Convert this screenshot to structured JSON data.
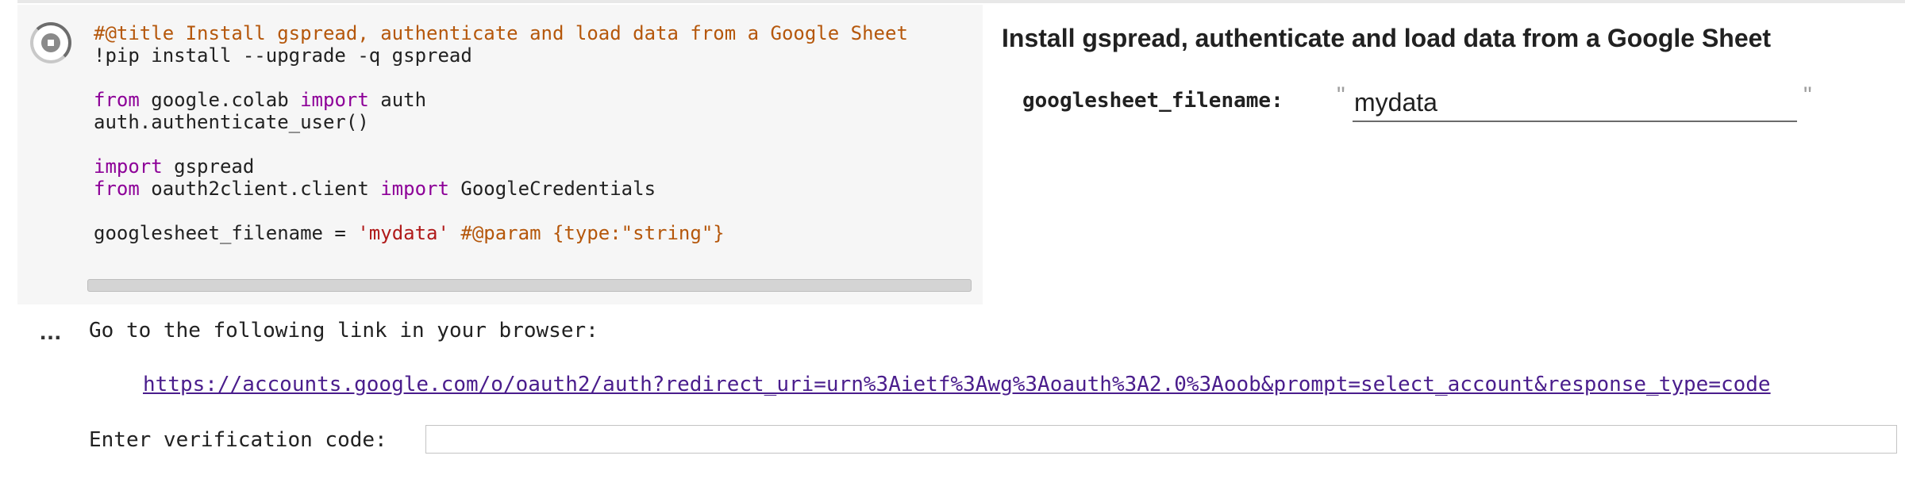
{
  "code_cell": {
    "run_button_icon": "stop-running-icon",
    "lines": [
      [
        {
          "t": "#@title Install gspread, authenticate and load data from a Google Sheet",
          "c": "comment"
        }
      ],
      [
        {
          "t": "!pip install --upgrade -q gspread",
          "c": "plain"
        }
      ],
      [],
      [
        {
          "t": "from",
          "c": "kw"
        },
        {
          "t": " google.colab ",
          "c": "plain"
        },
        {
          "t": "import",
          "c": "kw"
        },
        {
          "t": " auth",
          "c": "plain"
        }
      ],
      [
        {
          "t": "auth.authenticate_user()",
          "c": "plain"
        }
      ],
      [],
      [
        {
          "t": "import",
          "c": "kw"
        },
        {
          "t": " gspread",
          "c": "plain"
        }
      ],
      [
        {
          "t": "from",
          "c": "kw"
        },
        {
          "t": " oauth2client.client ",
          "c": "plain"
        },
        {
          "t": "import",
          "c": "kw"
        },
        {
          "t": " GoogleCredentials",
          "c": "plain"
        }
      ],
      [],
      [
        {
          "t": "googlesheet_filename = ",
          "c": "plain"
        },
        {
          "t": "'mydata'",
          "c": "str"
        },
        {
          "t": " #@param {type:\"string\"}",
          "c": "comment"
        }
      ]
    ]
  },
  "form": {
    "title": "Install gspread, authenticate and load data from a Google Sheet",
    "param_label": "googlesheet_filename:",
    "param_value": "mydata",
    "quote_open": "\"",
    "quote_close": "\""
  },
  "output": {
    "indicator": "...",
    "line1": "Go to the following link in your browser:",
    "auth_link": "https://accounts.google.com/o/oauth2/auth?redirect_uri=urn%3Aietf%3Awg%3Aoauth%3A2.0%3Aoob&prompt=select_account&response_type=code",
    "verification_label": "Enter verification code:",
    "verification_value": ""
  },
  "colors": {
    "comment": "#b5570b",
    "keyword": "#8d0098",
    "string": "#b01a1a",
    "link": "#4a1d8c",
    "cell_background": "#f6f6f6"
  }
}
